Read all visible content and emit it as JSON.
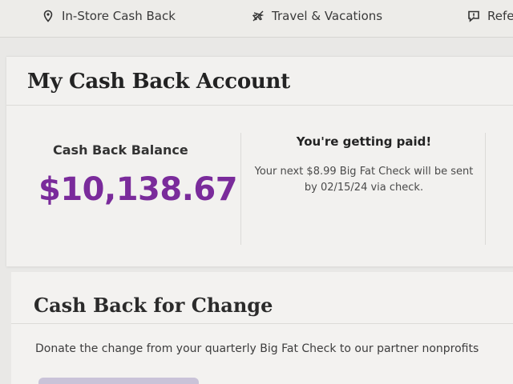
{
  "nav": {
    "items": [
      {
        "label": "In-Store Cash Back",
        "icon": "location-pin-icon"
      },
      {
        "label": "Travel & Vacations",
        "icon": "no-plane-icon"
      },
      {
        "label": "Refe",
        "icon": "chat-icon"
      }
    ]
  },
  "account": {
    "title": "My Cash Back Account",
    "balance_label": "Cash Back Balance",
    "balance_value": "$10,138.67",
    "paid_title": "You're getting paid!",
    "paid_desc": "Your next $8.99 Big Fat Check will be sent by 02/15/24 via check."
  },
  "change": {
    "title": "Cash Back for Change",
    "desc": "Donate the change from your quarterly Big Fat Check to our partner nonprofits"
  },
  "colors": {
    "balance": "#7a2b9b",
    "background": "#e9e8e6"
  }
}
